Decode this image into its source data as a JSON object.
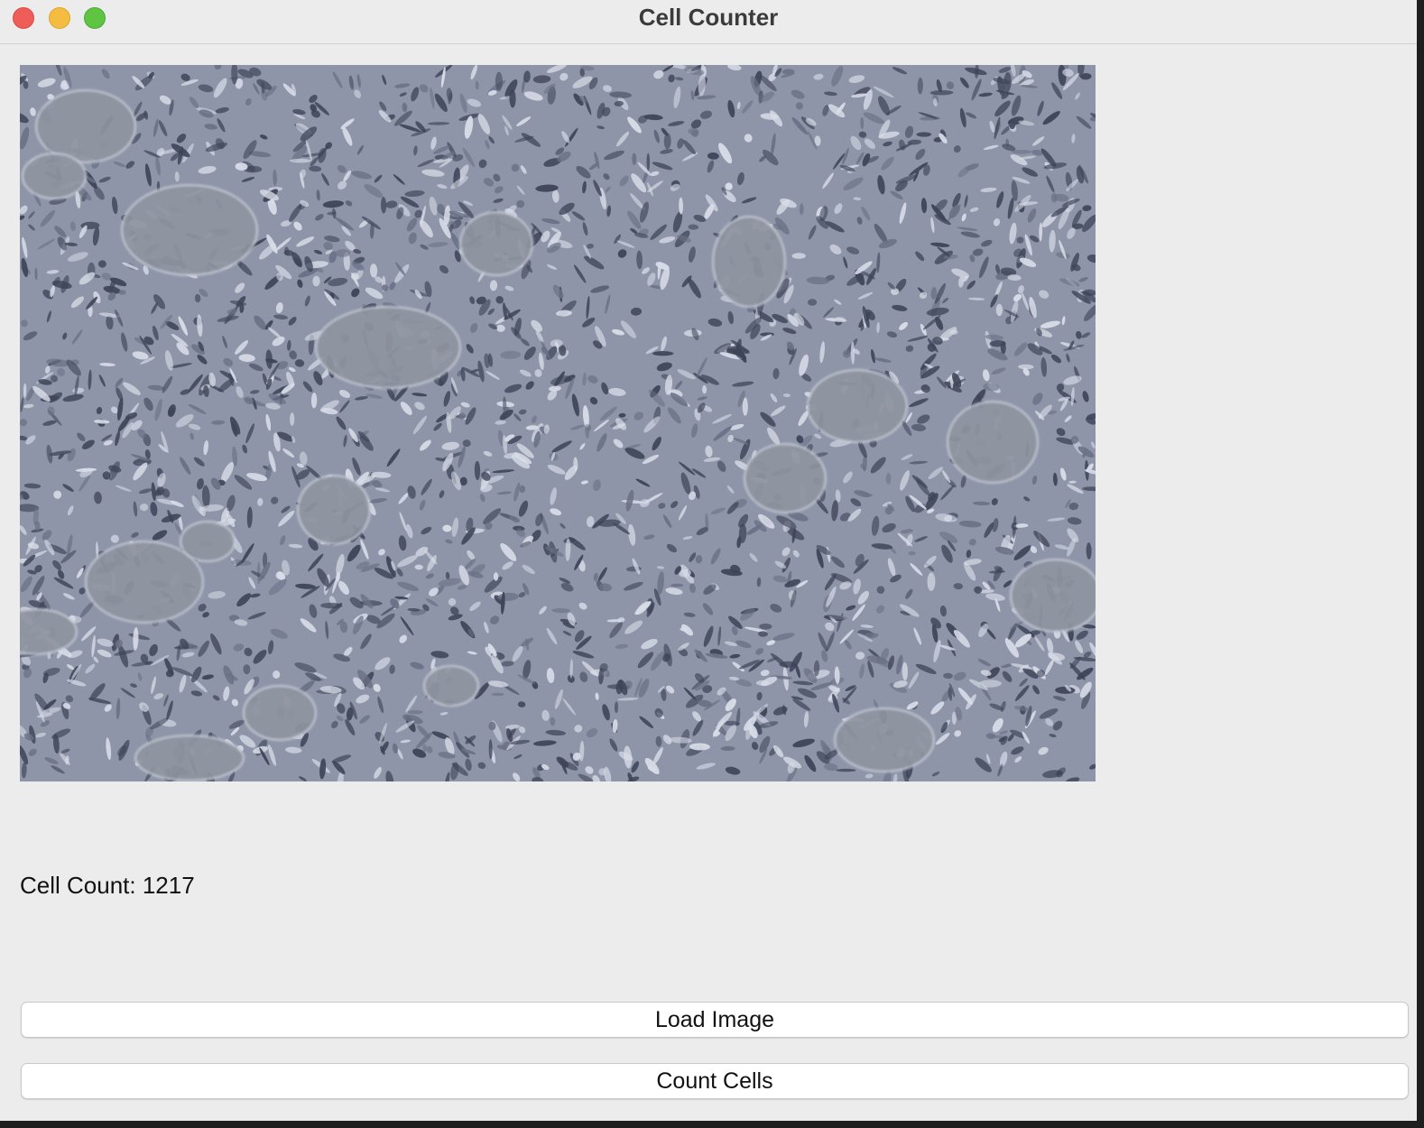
{
  "window": {
    "title": "Cell Counter"
  },
  "main": {
    "image_description_icon": "microscopy-image",
    "cell_count_text": "Cell Count: 1217"
  },
  "buttons": {
    "load_image": "Load Image",
    "count_cells": "Count Cells"
  },
  "colors": {
    "close": "#ee5d57",
    "minimize": "#f5bd3f",
    "maximize": "#5ec441",
    "background": "#ececec"
  }
}
